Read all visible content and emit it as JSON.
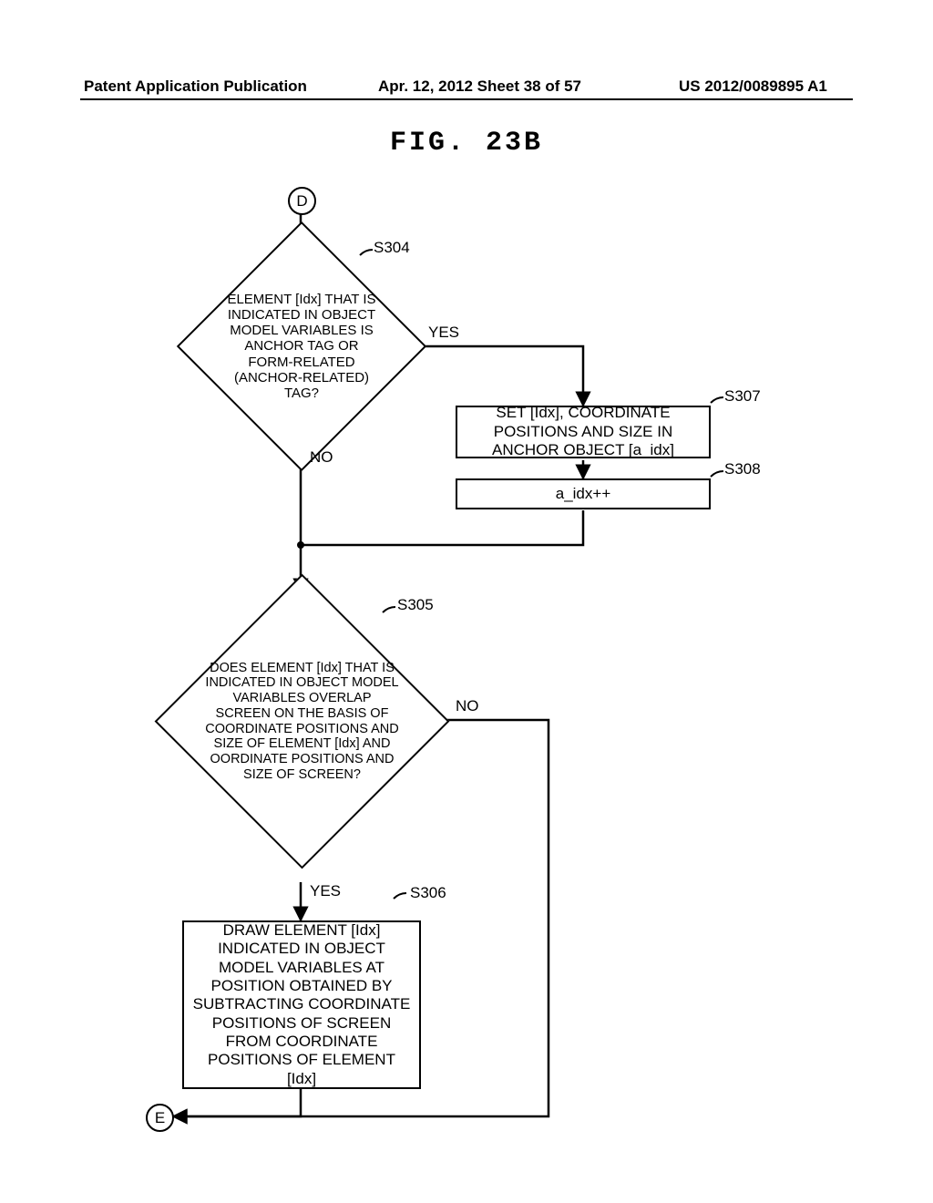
{
  "header": {
    "left": "Patent Application Publication",
    "mid": "Apr. 12, 2012  Sheet 38 of 57",
    "right": "US 2012/0089895 A1"
  },
  "figure_title": "FIG. 23B",
  "connectors": {
    "start": "D",
    "end": "E"
  },
  "steps": {
    "s304": {
      "id": "S304",
      "text": "ELEMENT [Idx] THAT IS INDICATED IN OBJECT MODEL VARIABLES IS ANCHOR TAG OR FORM-RELATED (ANCHOR-RELATED) TAG?",
      "yes": "YES",
      "no": "NO"
    },
    "s307": {
      "id": "S307",
      "text": "SET [Idx], COORDINATE POSITIONS AND SIZE IN ANCHOR OBJECT [a_idx]"
    },
    "s308": {
      "id": "S308",
      "text": "a_idx++"
    },
    "s305": {
      "id": "S305",
      "text": "DOES ELEMENT [Idx] THAT IS INDICATED IN OBJECT MODEL VARIABLES OVERLAP SCREEN ON THE BASIS OF COORDINATE POSITIONS AND SIZE OF ELEMENT [Idx] AND OORDINATE POSITIONS AND SIZE OF SCREEN?",
      "yes": "YES",
      "no": "NO"
    },
    "s306": {
      "id": "S306",
      "text": "DRAW ELEMENT [Idx] INDICATED IN OBJECT MODEL VARIABLES AT POSITION OBTAINED BY SUBTRACTING COORDINATE POSITIONS OF SCREEN FROM COORDINATE POSITIONS OF ELEMENT [Idx]"
    }
  }
}
